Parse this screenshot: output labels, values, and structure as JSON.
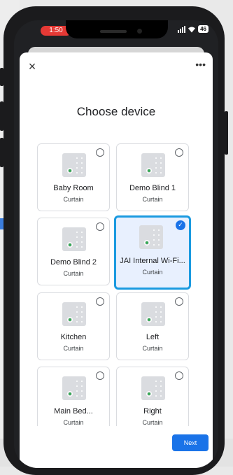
{
  "status_bar": {
    "time": "1:50",
    "battery": "46"
  },
  "dialog": {
    "title": "Choose device",
    "close_icon": "close-icon",
    "more_icon": "more-horizontal-icon",
    "close_glyph": "×",
    "more_glyph": "•••",
    "next_label": "Next"
  },
  "devices": [
    {
      "name": "Baby Room",
      "type": "Curtain",
      "selected": false
    },
    {
      "name": "Demo Blind 1",
      "type": "Curtain",
      "selected": false
    },
    {
      "name": "Demo Blind 2",
      "type": "Curtain",
      "selected": false
    },
    {
      "name": "JAI Internal Wi-Fi...",
      "type": "Curtain",
      "selected": true
    },
    {
      "name": "Kitchen",
      "type": "Curtain",
      "selected": false
    },
    {
      "name": "Left",
      "type": "Curtain",
      "selected": false
    },
    {
      "name": "Main Bed...",
      "type": "Curtain",
      "selected": false
    },
    {
      "name": "Right",
      "type": "Curtain",
      "selected": false
    }
  ],
  "colors": {
    "accent": "#1a73e8",
    "selected_border": "#1a9ae0",
    "selected_bg": "#e8f0fe",
    "status_time_bg": "#e53935",
    "device_led": "#34a853"
  }
}
